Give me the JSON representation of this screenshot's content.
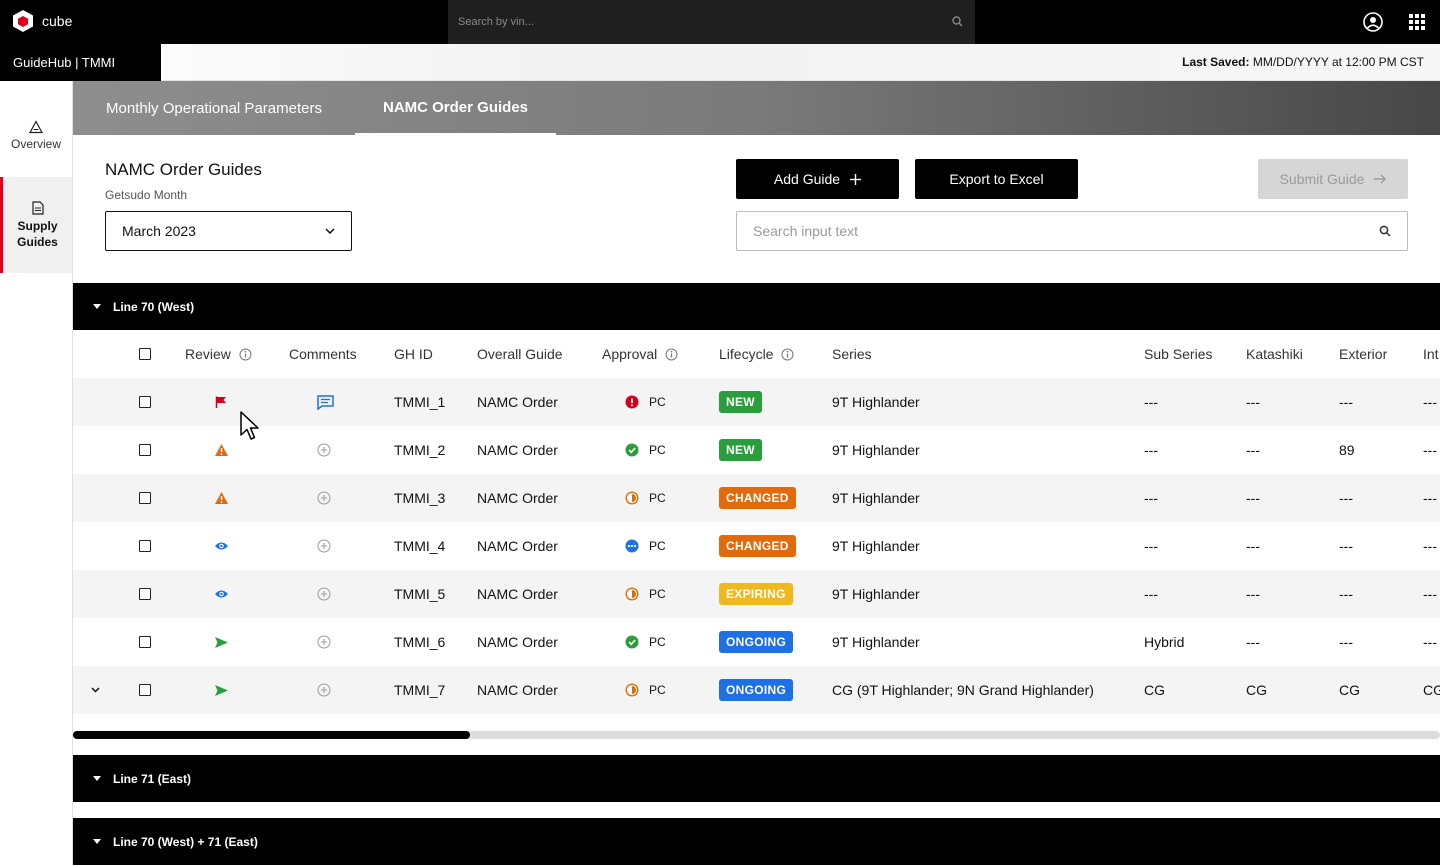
{
  "topbar": {
    "logo_text": "cube",
    "search_placeholder": "Search by vin..."
  },
  "subbar": {
    "app_label": "GuideHub | TMMI",
    "last_saved_label": "Last Saved:",
    "last_saved_value": "MM/DD/YYYY at 12:00 PM CST"
  },
  "sidenav": {
    "items": [
      {
        "label": "Overview"
      },
      {
        "label": "Supply Guides"
      }
    ]
  },
  "tabs": [
    {
      "label": "Monthly Operational Parameters"
    },
    {
      "label": "NAMC Order Guides"
    }
  ],
  "header": {
    "title": "NAMC Order Guides",
    "month_label": "Getsudo Month",
    "month_value": "March 2023",
    "add_label": "Add Guide",
    "export_label": "Export to Excel",
    "submit_label": "Submit Guide",
    "search_placeholder": "Search input text"
  },
  "groups": [
    {
      "label": "Line 70 (West)"
    },
    {
      "label": "Line 71 (East)"
    },
    {
      "label": "Line 70 (West) + 71 (East)"
    }
  ],
  "table": {
    "columns": [
      "Review",
      "Comments",
      "GH ID",
      "Overall Guide",
      "Approval",
      "Lifecycle",
      "Series",
      "Sub Series",
      "Katashiki",
      "Exterior",
      "Int"
    ],
    "rows": [
      {
        "review": "flag",
        "comment": "comment-filled",
        "id": "TMMI_1",
        "guide": "NAMC Order",
        "approval_icon": "error",
        "approval": "PC",
        "lifecycle": "NEW",
        "lc_class": "new",
        "series": "9T Highlander",
        "sub": "---",
        "kata": "---",
        "ext": "---",
        "int": "---"
      },
      {
        "review": "warning",
        "comment": "add",
        "id": "TMMI_2",
        "guide": "NAMC Order",
        "approval_icon": "check",
        "approval": "PC",
        "lifecycle": "NEW",
        "lc_class": "new",
        "series": "9T Highlander",
        "sub": "---",
        "kata": "---",
        "ext": "89",
        "int": "---"
      },
      {
        "review": "warning",
        "comment": "add",
        "id": "TMMI_3",
        "guide": "NAMC Order",
        "approval_icon": "partial",
        "approval": "PC",
        "lifecycle": "CHANGED",
        "lc_class": "changed",
        "series": "9T Highlander",
        "sub": "---",
        "kata": "---",
        "ext": "---",
        "int": "---"
      },
      {
        "review": "eye",
        "comment": "add",
        "id": "TMMI_4",
        "guide": "NAMC Order",
        "approval_icon": "pending",
        "approval": "PC",
        "lifecycle": "CHANGED",
        "lc_class": "changed",
        "series": "9T Highlander",
        "sub": "---",
        "kata": "---",
        "ext": "---",
        "int": "---"
      },
      {
        "review": "eye",
        "comment": "add",
        "id": "TMMI_5",
        "guide": "NAMC Order",
        "approval_icon": "partial",
        "approval": "PC",
        "lifecycle": "EXPIRING",
        "lc_class": "expiring",
        "series": "9T Highlander",
        "sub": "---",
        "kata": "---",
        "ext": "---",
        "int": "---"
      },
      {
        "review": "send",
        "comment": "add",
        "id": "TMMI_6",
        "guide": "NAMC Order",
        "approval_icon": "check",
        "approval": "PC",
        "lifecycle": "ONGOING",
        "lc_class": "ongoing",
        "series": "9T Highlander",
        "sub": "Hybrid",
        "kata": "---",
        "ext": "---",
        "int": "---"
      },
      {
        "review": "send",
        "comment": "add",
        "id": "TMMI_7",
        "guide": "NAMC Order",
        "approval_icon": "partial",
        "approval": "PC",
        "lifecycle": "ONGOING",
        "lc_class": "ongoing",
        "series": "CG (9T Highlander; 9N Grand Highlander)",
        "sub": "CG",
        "kata": "CG",
        "ext": "CG",
        "int": "CG",
        "expandable": true
      }
    ]
  },
  "colors": {
    "accent_red": "#e0001b",
    "new": "#2a9d3d",
    "changed": "#e06a0c",
    "expiring": "#f0b81f",
    "ongoing": "#1f6fe5",
    "review_blue": "#1f6fe5",
    "send_green": "#2a9d3d",
    "flag_red": "#d0021b",
    "warn_orange": "#e06a0c"
  }
}
